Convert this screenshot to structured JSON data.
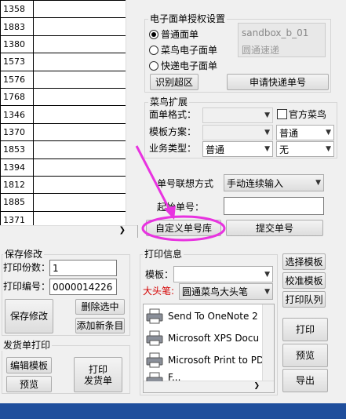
{
  "grid": {
    "rows": [
      "1358",
      "1883",
      "1380",
      "1573",
      "1576",
      "1768",
      "1346",
      "1370",
      "1853",
      "1394",
      "1812",
      "1885",
      "1371"
    ]
  },
  "waybill_auth": {
    "title": "电子面单授权设置",
    "options": [
      {
        "label": "普通面单",
        "checked": true
      },
      {
        "label": "菜鸟电子面单",
        "checked": false
      },
      {
        "label": "快递电子面单",
        "checked": false
      }
    ],
    "sandbox_line1": "sandbox_b_01",
    "sandbox_line2": "圆通速递",
    "identify_button": "识别超区",
    "apply_button": "申请快递单号"
  },
  "cainiao_ext": {
    "title": "菜鸟扩展",
    "waybill_format_label": "面单格式：",
    "official_cainiao_label": "官方菜鸟",
    "template_label": "模板方案：",
    "template_value": "普通",
    "business_type_label": "业务类型：",
    "business_type_value": "普通",
    "business_extra_value": "无"
  },
  "tracking": {
    "mode_label": "单号联想方式",
    "mode_value": "手动连续输入",
    "start_label": "起始单号：",
    "start_value": "",
    "custom_library_button": "自定义单号库",
    "submit_button": "提交单号"
  },
  "save_modify": {
    "title": "保存修改",
    "copies_label": "打印份数：",
    "copies_value": "1",
    "number_label": "打印编号：",
    "number_value": "0000014226",
    "save_button": "保存修改",
    "delete_button": "删除选中",
    "add_button": "添加新条目"
  },
  "invoice_print": {
    "title": "发货单打印",
    "edit_template_button": "编辑模板",
    "preview_button": "预览",
    "print_invoice_button": "打印\n发货单"
  },
  "print_info": {
    "title": "打印信息",
    "template_label": "模板：",
    "template_value": "",
    "big_pen_label": "大头笔:",
    "big_pen_value": "圆通菜鸟大头笔",
    "printers": [
      "Send To OneNote 2",
      "Microsoft XPS Docu",
      "Microsoft Print to PD",
      "F..."
    ],
    "select_template_button": "选择模板",
    "calibrate_template_button": "校准模板",
    "print_queue_button": "打印队列",
    "print_button": "打印",
    "preview_button": "预览",
    "export_button": "导出"
  },
  "colors": {
    "annotation": "#e833e0",
    "taskbar": "#1f4e9c",
    "big_pen_label": "#d40000"
  }
}
